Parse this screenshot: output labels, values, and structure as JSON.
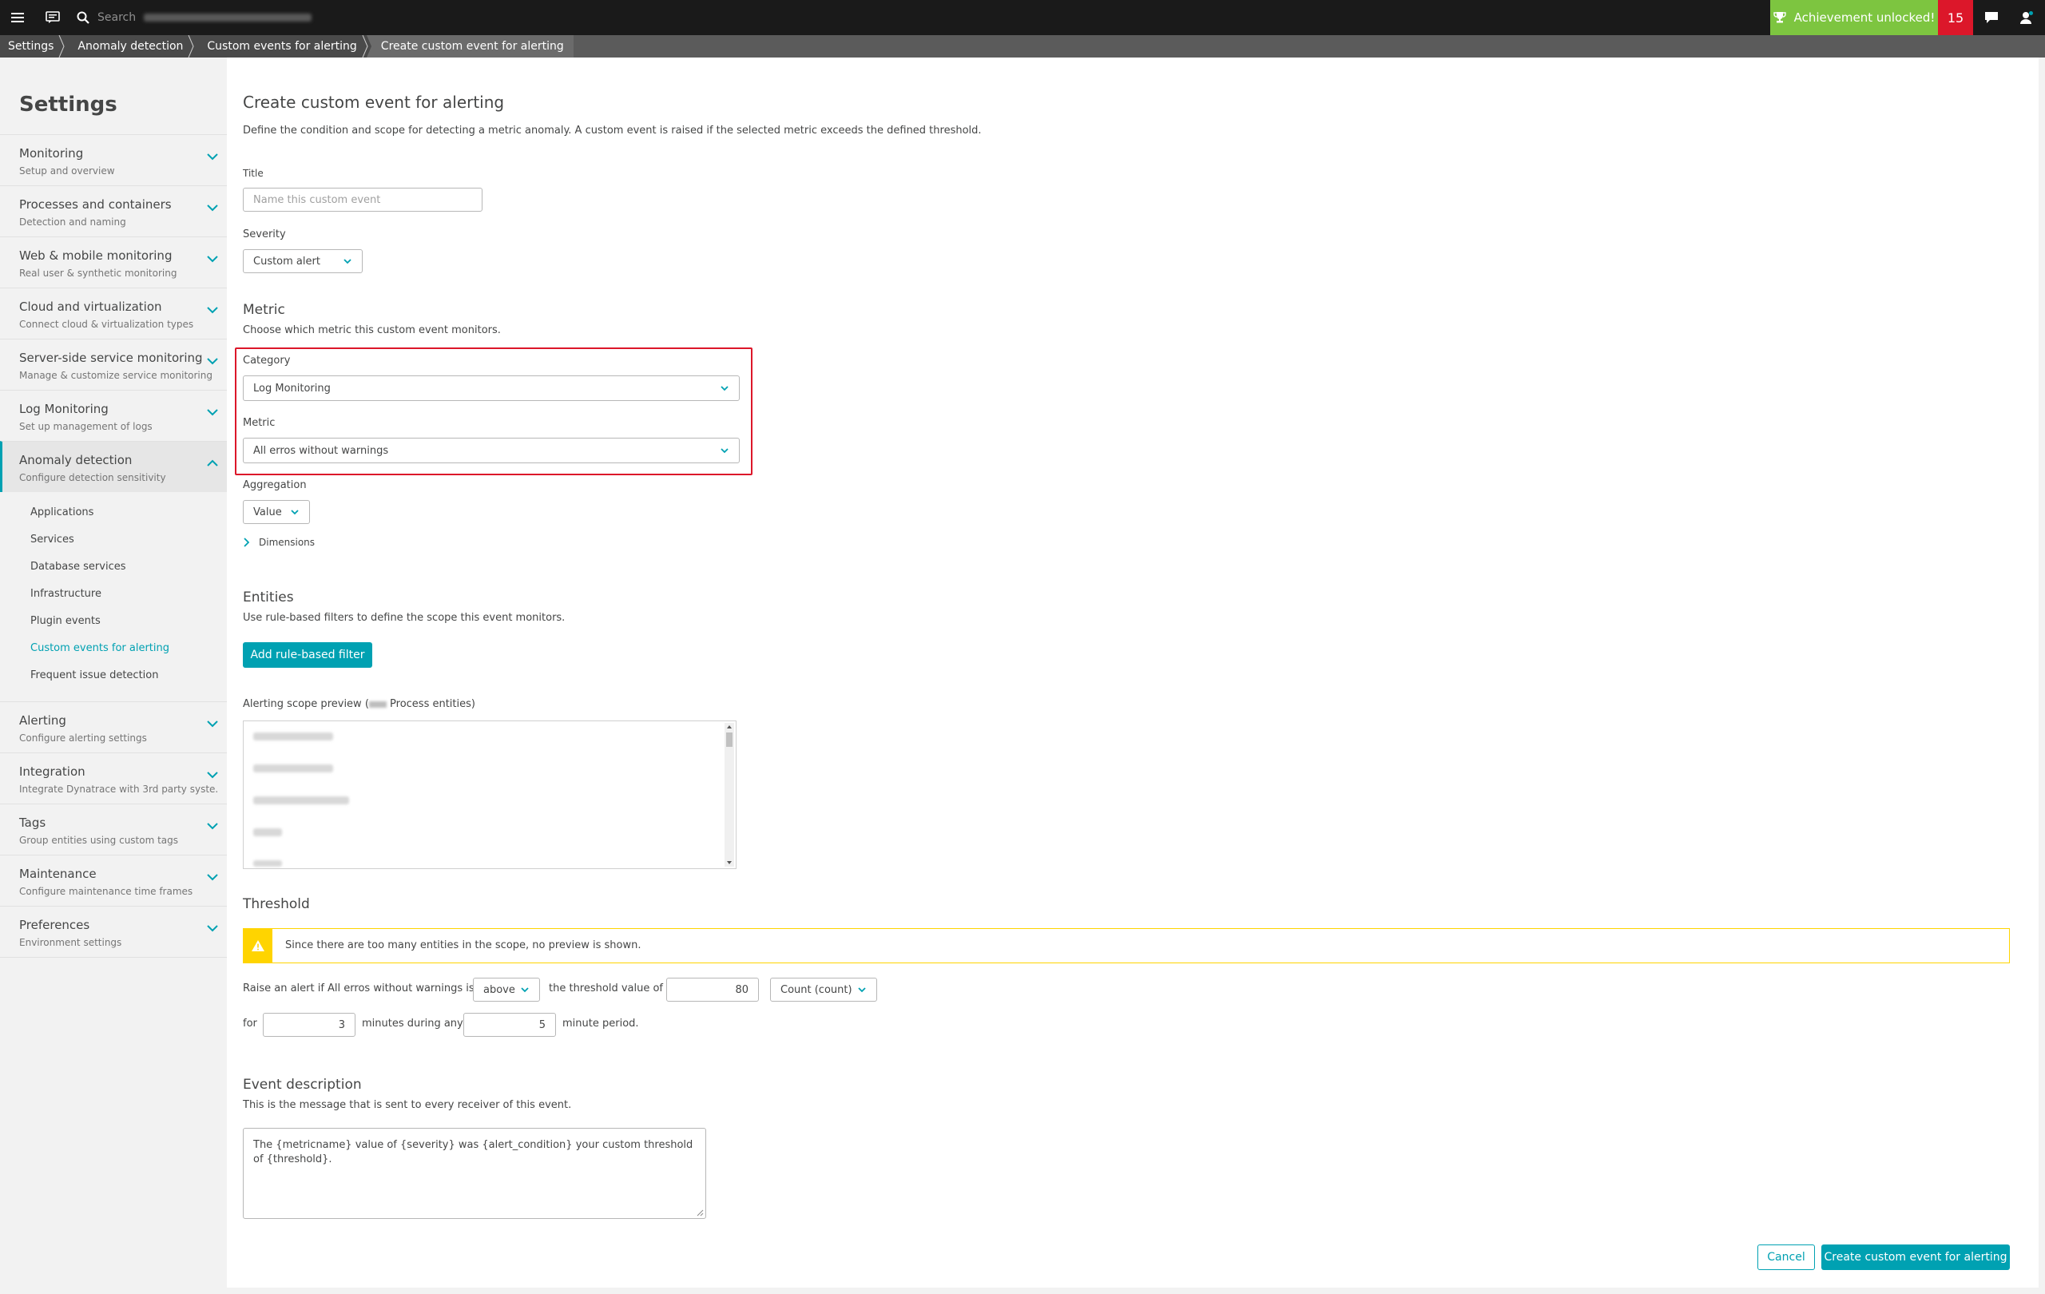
{
  "topbar": {
    "search_placeholder": "Search",
    "achievement_label": "Achievement unlocked!",
    "notification_count": "15"
  },
  "breadcrumb": [
    "Settings",
    "Anomaly detection",
    "Custom events for alerting",
    "Create custom event for alerting"
  ],
  "sidebar": {
    "title": "Settings",
    "sections": [
      {
        "title": "Monitoring",
        "subtitle": "Setup and overview"
      },
      {
        "title": "Processes and containers",
        "subtitle": "Detection and naming"
      },
      {
        "title": "Web & mobile monitoring",
        "subtitle": "Real user & synthetic monitoring"
      },
      {
        "title": "Cloud and virtualization",
        "subtitle": "Connect cloud & virtualization types"
      },
      {
        "title": "Server-side service monitoring",
        "subtitle": "Manage & customize service monitoring"
      },
      {
        "title": "Log Monitoring",
        "subtitle": "Set up management of logs"
      },
      {
        "title": "Anomaly detection",
        "subtitle": "Configure detection sensitivity"
      },
      {
        "title": "Alerting",
        "subtitle": "Configure alerting settings"
      },
      {
        "title": "Integration",
        "subtitle": "Integrate Dynatrace with 3rd party syste..."
      },
      {
        "title": "Tags",
        "subtitle": "Group entities using custom tags"
      },
      {
        "title": "Maintenance",
        "subtitle": "Configure maintenance time frames"
      },
      {
        "title": "Preferences",
        "subtitle": "Environment settings"
      }
    ],
    "subitems": [
      "Applications",
      "Services",
      "Database services",
      "Infrastructure",
      "Plugin events",
      "Custom events for alerting",
      "Frequent issue detection"
    ]
  },
  "form": {
    "heading": "Create custom event for alerting",
    "description": "Define the condition and scope for detecting a metric anomaly. A custom event is raised if the selected metric exceeds the defined threshold.",
    "title_label": "Title",
    "title_placeholder": "Name this custom event",
    "severity_label": "Severity",
    "severity_value": "Custom alert",
    "metric_heading": "Metric",
    "metric_description": "Choose which metric this custom event monitors.",
    "category_label": "Category",
    "category_value": "Log Monitoring",
    "metric_label": "Metric",
    "metric_value": "All erros without warnings",
    "aggregation_label": "Aggregation",
    "aggregation_value": "Value",
    "dimensions_label": "Dimensions",
    "entities_heading": "Entities",
    "entities_description": "Use rule-based filters to define the scope this event monitors.",
    "add_filter_button": "Add rule-based filter",
    "scope_preview_prefix": "Alerting scope preview (",
    "scope_preview_suffix": " Process entities)",
    "threshold_heading": "Threshold",
    "threshold_warning": "Since there are too many entities in the scope, no preview is shown.",
    "raise_alert_text": "Raise an alert if All erros without warnings is",
    "condition_value": "above",
    "threshold_value_text": "the threshold value of",
    "threshold_value": "80",
    "unit_value": "Count (count)",
    "for_text": "for",
    "minutes_value": "3",
    "minutes_during_text": "minutes during any",
    "period_value": "5",
    "minute_period_text": "minute period.",
    "event_desc_heading": "Event description",
    "event_desc_description": "This is the message that is sent to every receiver of this event.",
    "event_desc_value": "The {metricname} value of {severity} was {alert_condition} your custom threshold of {threshold}.",
    "cancel_button": "Cancel",
    "create_button": "Create custom event for alerting"
  },
  "colors": {
    "accent": "#00a1b2",
    "achievement": "#7dc540",
    "notification": "#dc172a",
    "warning": "#ffd400",
    "highlight": "#dc172a"
  }
}
